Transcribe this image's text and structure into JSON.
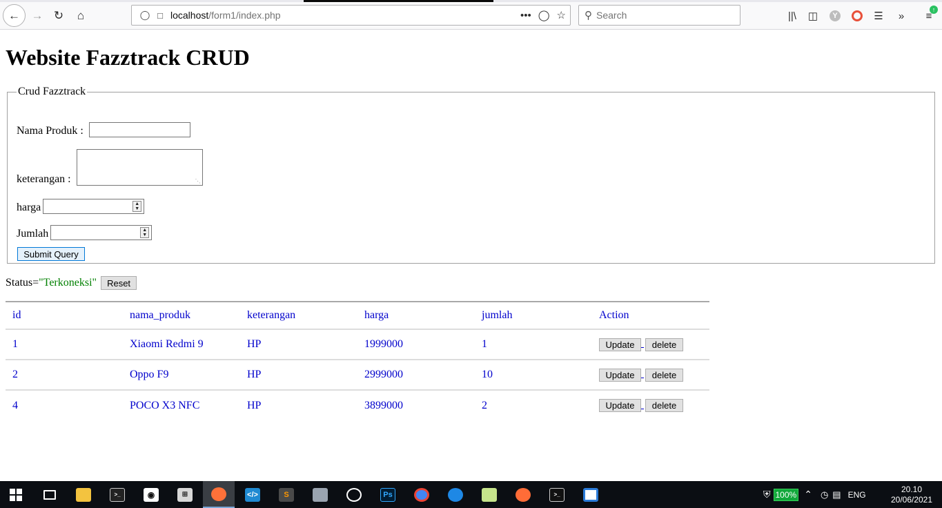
{
  "browser": {
    "url_host": "localhost",
    "url_path": "/form1/index.php",
    "search_placeholder": "Search",
    "update_badge": "↑"
  },
  "page": {
    "title": "Website Fazztrack CRUD",
    "form": {
      "legend": "Crud Fazztrack",
      "nama_produk_label": "Nama Produk : ",
      "keterangan_label": "keterangan : ",
      "harga_label": "harga",
      "jumlah_label": "Jumlah",
      "submit_label": "Submit Query"
    },
    "status": {
      "prefix": "Status=",
      "value": "\"Terkoneksi\"",
      "reset_label": "Reset"
    },
    "table": {
      "headers": [
        "id",
        "nama_produk",
        "keterangan",
        "harga",
        "jumlah",
        "Action"
      ],
      "rows": [
        {
          "id": "1",
          "nama_produk": "Xiaomi Redmi 9",
          "keterangan": "HP",
          "harga": "1999000",
          "jumlah": "1"
        },
        {
          "id": "2",
          "nama_produk": "Oppo F9",
          "keterangan": "HP",
          "harga": "2999000",
          "jumlah": "10"
        },
        {
          "id": "4",
          "nama_produk": "POCO X3 NFC",
          "keterangan": "HP",
          "harga": "3899000",
          "jumlah": "2"
        }
      ],
      "update_label": "Update",
      "delete_label": "delete"
    }
  },
  "taskbar": {
    "battery": "100%",
    "language": "ENG",
    "time": "20.10",
    "date": "20/06/2021"
  },
  "colors": {
    "link": "#0000cc",
    "status_ok": "#008000",
    "taskbar_bg": "#0b0e13"
  }
}
